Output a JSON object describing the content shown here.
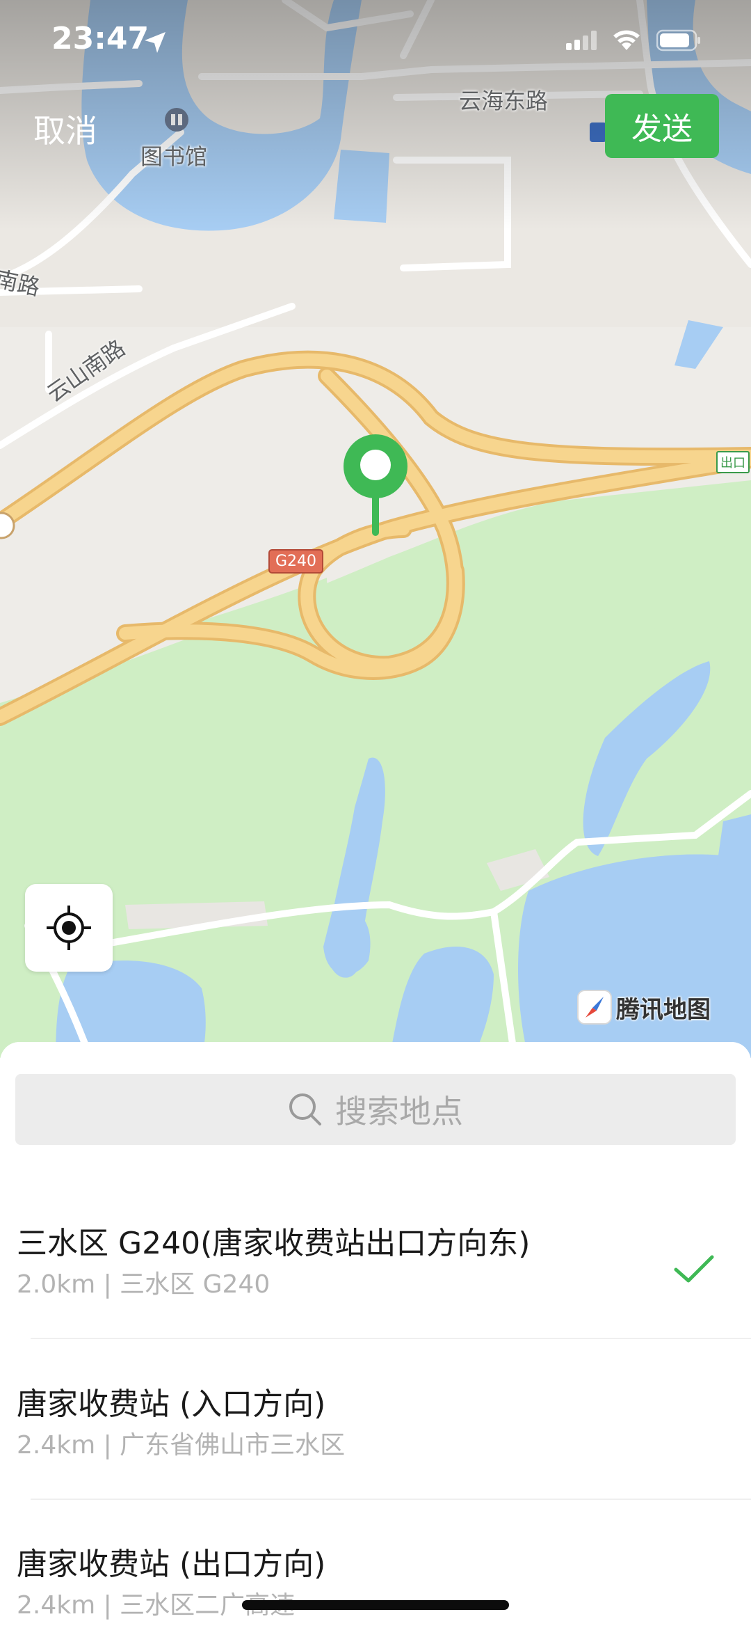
{
  "status_bar": {
    "time": "23:47"
  },
  "header": {
    "cancel_label": "取消",
    "send_label": "发送"
  },
  "map": {
    "labels": {
      "library": "图书馆",
      "yunhai_road": "云海东路",
      "nan_road": "南路",
      "yunshan_road": "云山南路",
      "highway_badge": "G240",
      "exit_badge": "出口"
    },
    "brand": "腾讯地图",
    "colors": {
      "water": "#a7cdf3",
      "green": "#cfeec4",
      "highway": "#f7d58e",
      "pin": "#3fb955"
    }
  },
  "search": {
    "placeholder": "搜索地点"
  },
  "results": [
    {
      "title": "三水区 G240(唐家收费站出口方向东)",
      "subtitle": "2.0km | 三水区 G240",
      "selected": true
    },
    {
      "title": "唐家收费站 (入口方向)",
      "subtitle": "2.4km | 广东省佛山市三水区",
      "selected": false
    },
    {
      "title": "唐家收费站 (出口方向)",
      "subtitle": "2.4km | 三水区二广高速",
      "selected": false
    }
  ]
}
